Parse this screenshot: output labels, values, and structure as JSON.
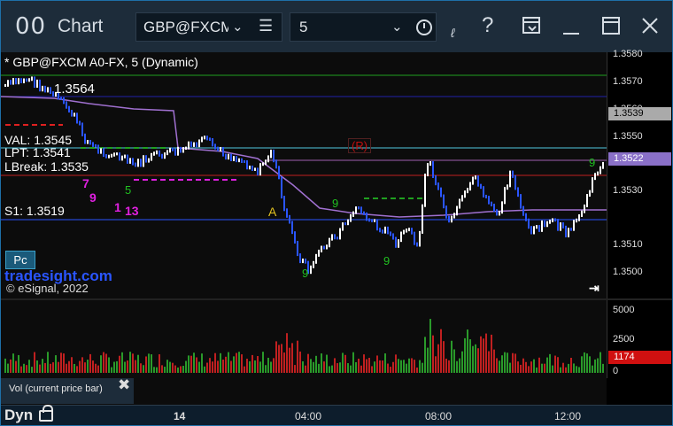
{
  "titlebar": {
    "app_icon": "00",
    "title": "Chart",
    "symbol": "GBP@FXCM",
    "interval": "5",
    "colors": {
      "bg": "#1d2c3a",
      "fg": "#d6dde4"
    }
  },
  "chart": {
    "header": "* GBP@FXCM A0-FX, 5 (Dynamic)",
    "labels": {
      "top_value": "1.3564",
      "val": "VAL: 1.3545",
      "lpt": "LPT: 1.3541",
      "lbreak": "LBreak: 1.3535",
      "s1": "S1: 1.3519",
      "marker_a": "A",
      "marker_r": "(R)",
      "pc_button": "Pc",
      "watermark": "tradesight.com",
      "copyright": "© eSignal, 2022"
    },
    "counts": {
      "c7": "7",
      "c9a": "9",
      "c1": "1",
      "c13": "13",
      "c5": "5",
      "c9b": "9",
      "c9c": "9",
      "c9d": "9",
      "c9e": "9"
    },
    "price_axis": [
      "1.3580",
      "1.3570",
      "1.3560",
      "1.3550",
      "1.3530",
      "1.3510",
      "1.3500"
    ],
    "last_price": "1.3539",
    "ma_price": "1.3522",
    "volume_axis": [
      "5000",
      "2500",
      "0"
    ],
    "last_volume": "1174",
    "volume_legend": "Vol (current price bar)",
    "time_axis": [
      "14",
      "04:00",
      "08:00",
      "12:00"
    ],
    "mode": "Dyn",
    "colors": {
      "up": "#ffffff",
      "down": "#2a55ff",
      "ma": "#a070d0",
      "vol_up": "#2a9a2a",
      "vol_down": "#c02020"
    }
  }
}
